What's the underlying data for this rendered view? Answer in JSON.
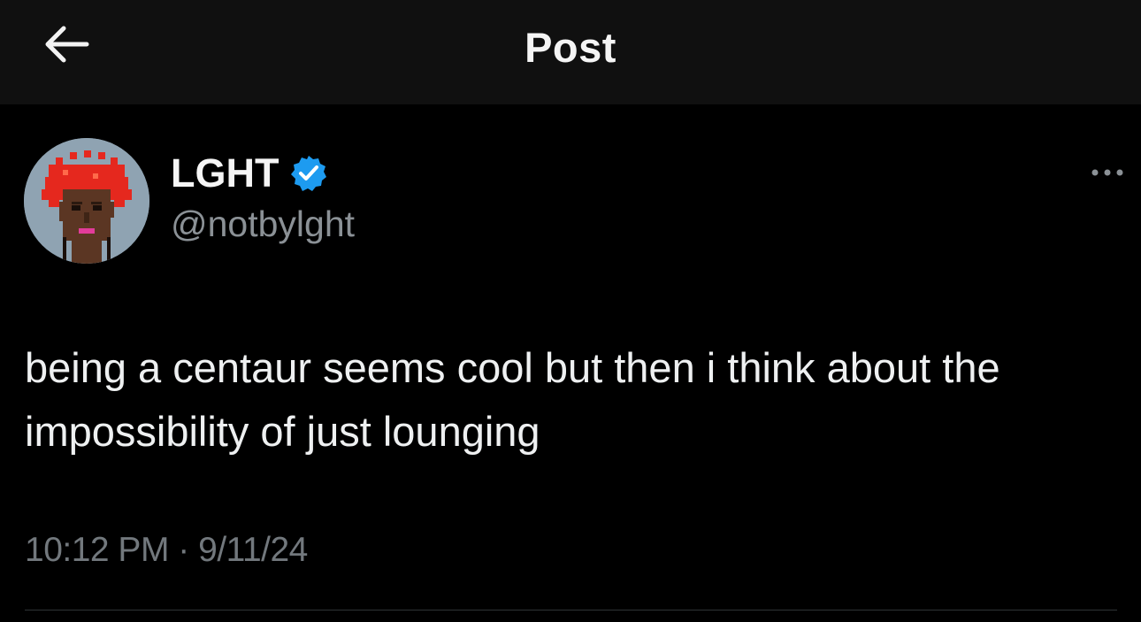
{
  "header": {
    "title": "Post",
    "back_icon": "arrow-left-icon"
  },
  "post": {
    "author": {
      "display_name": "LGHT",
      "handle": "@notbylght",
      "verified": true,
      "verified_color": "#1d9bf0",
      "avatar_icon": "pixel-art-avatar"
    },
    "text": "being a centaur seems cool but then i think about the impossibility of just lounging",
    "time": "10:12 PM",
    "separator": "·",
    "date": "9/11/24",
    "more_icon": "more-options-icon"
  },
  "colors": {
    "background": "#000000",
    "header_background": "#101010",
    "text_primary": "#e7e9ea",
    "text_secondary": "#71767b",
    "divider": "#2f3336"
  }
}
